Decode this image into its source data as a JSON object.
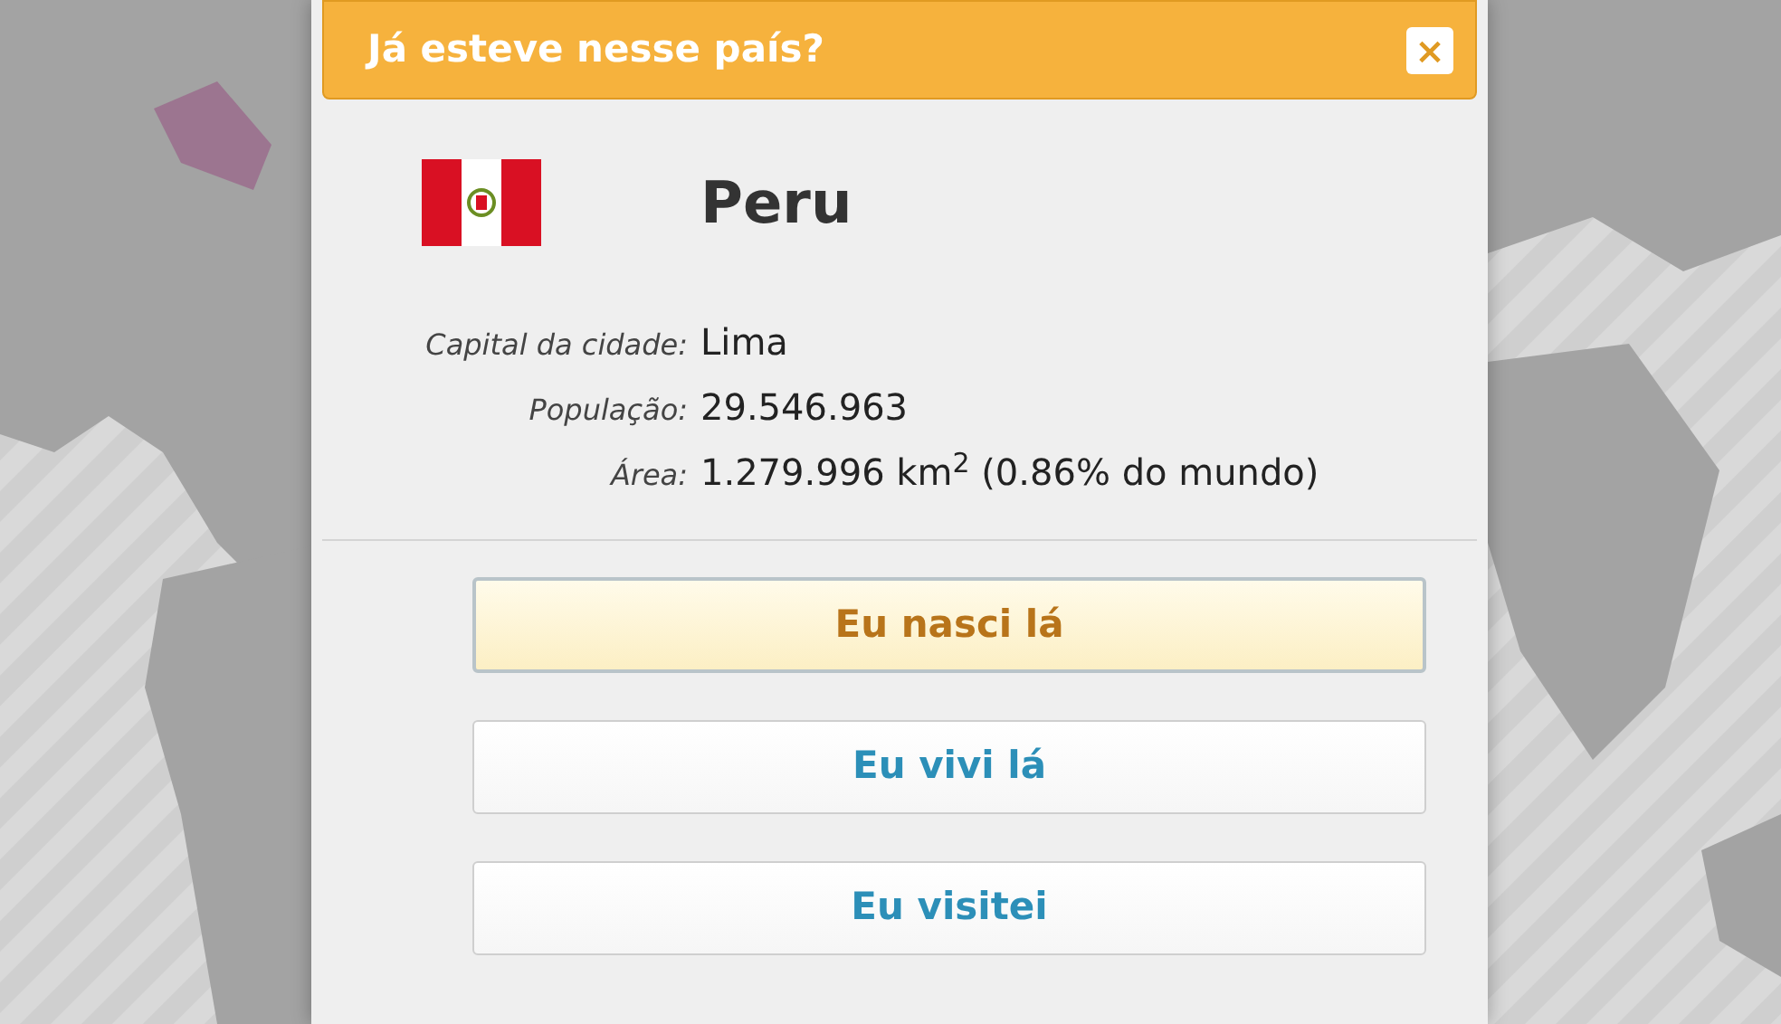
{
  "dialog": {
    "title": "Já esteve nesse país?",
    "close": "×"
  },
  "country": {
    "name": "Peru"
  },
  "facts": [
    {
      "label": "Capital da cidade:",
      "value": "Lima"
    },
    {
      "label": "População:",
      "value": "29.546.963"
    },
    {
      "label": "Área:",
      "value": "1.279.996 km$^{2}$ (0.86% do mundo)"
    }
  ],
  "options": [
    {
      "label": "Eu nasci lá",
      "selected": true
    },
    {
      "label": "Eu vivi lá",
      "selected": false
    },
    {
      "label": "Eu visitei",
      "selected": false
    }
  ]
}
